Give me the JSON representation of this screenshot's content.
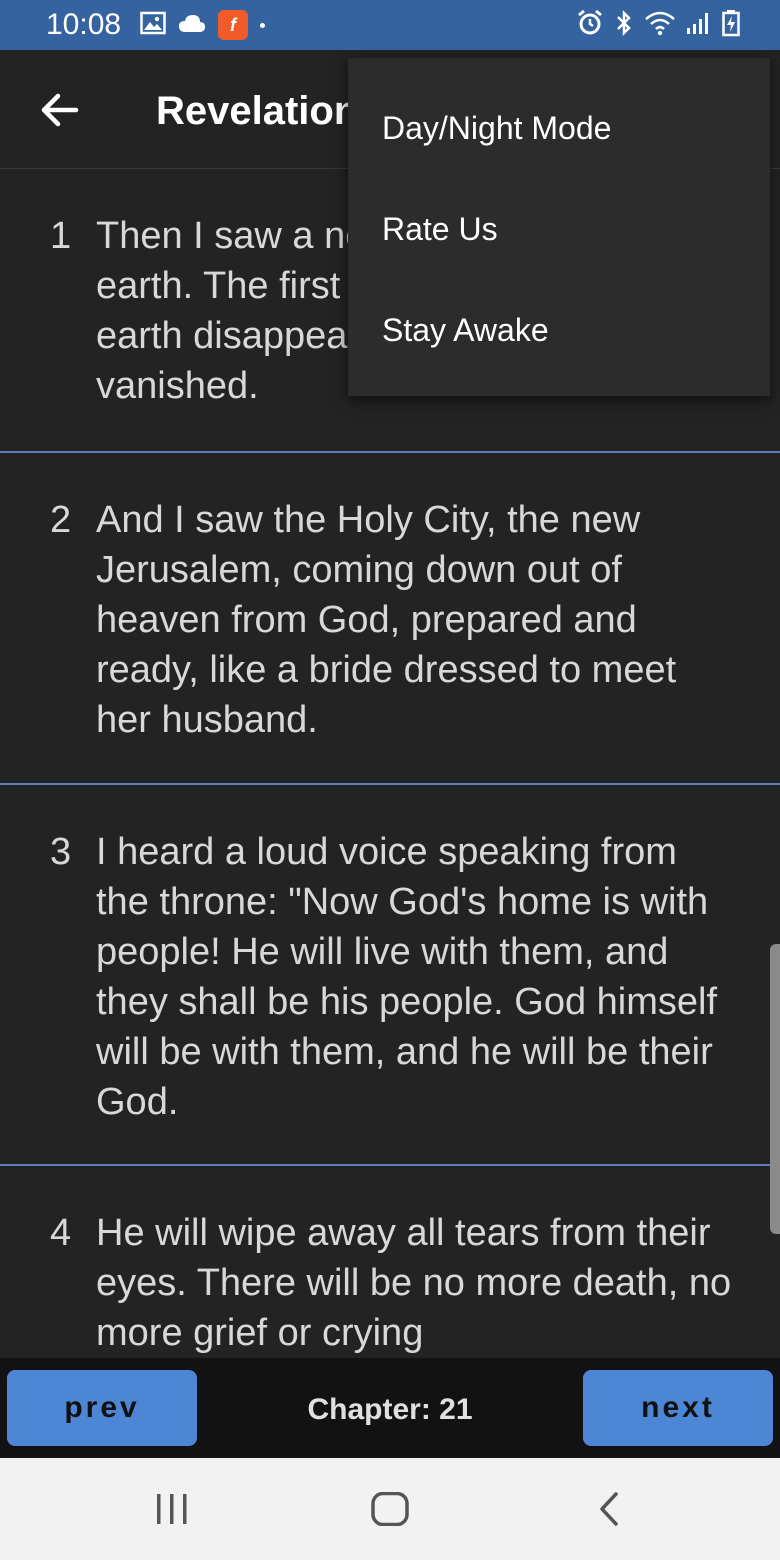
{
  "status_bar": {
    "time": "10:08"
  },
  "app_bar": {
    "title": "Revelation"
  },
  "menu": {
    "items": [
      {
        "label": "Day/Night Mode"
      },
      {
        "label": "Rate Us"
      },
      {
        "label": "Stay Awake"
      }
    ]
  },
  "verses": [
    {
      "num": "1",
      "text": "Then I saw a new heaven and a new earth. The first heaven and the first earth disappeared, and the sea vanished."
    },
    {
      "num": "2",
      "text": "And I saw the Holy City, the new Jerusalem, coming down out of heaven from God, prepared and ready, like a bride dressed to meet her husband."
    },
    {
      "num": "3",
      "text": "I heard a loud voice speaking from the throne: \"Now God's home is with people! He will live with them, and they shall be his people. God himself will be with them, and he will be their God."
    },
    {
      "num": "4",
      "text": "He will wipe away all tears from their eyes. There will be no more death, no more grief or crying"
    }
  ],
  "bottom_bar": {
    "prev_label": "prev",
    "chapter_label": "Chapter: 21",
    "next_label": "next"
  },
  "colors": {
    "status_bar": "#3563a0",
    "background": "#232323",
    "accent_button": "#4d86d4",
    "divider": "#5a7fbf"
  },
  "icons": {
    "status_left": [
      "gallery-icon",
      "cloud-icon",
      "flipboard-icon"
    ],
    "status_right": [
      "alarm-icon",
      "bluetooth-icon",
      "wifi-icon",
      "signal-icon",
      "battery-charging-icon"
    ],
    "app_bar": "back-arrow-icon",
    "system_nav": [
      "recents-icon",
      "home-icon",
      "back-icon"
    ]
  }
}
